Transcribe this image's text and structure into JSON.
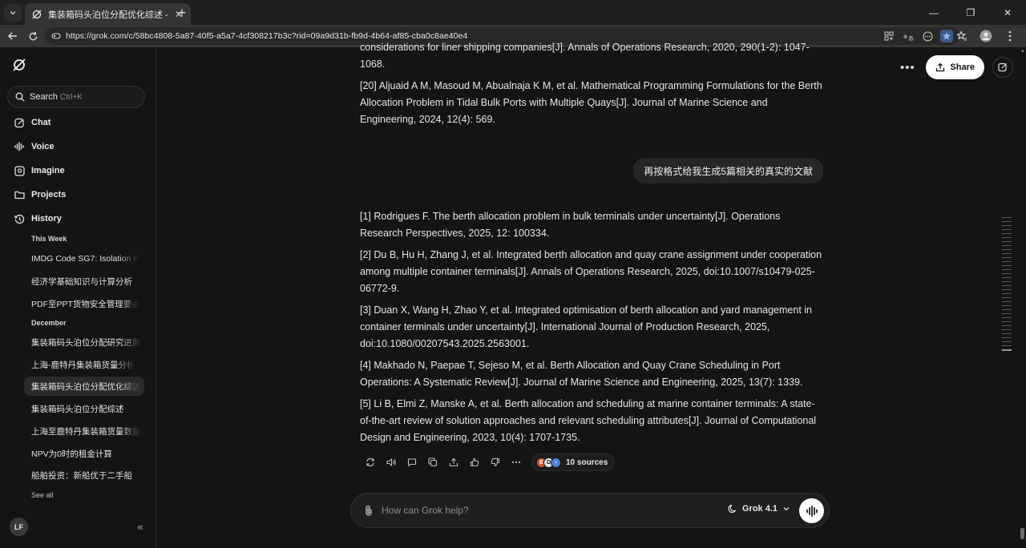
{
  "browser": {
    "tab_title": "集装箱码头泊位分配优化综述 - Grok",
    "url": "https://grok.com/c/58bc4808-5a87-40f5-a5a7-4cf308217b3c?rid=09a9d31b-fb9d-4b64-af85-cba0c8ae40e4"
  },
  "sidebar": {
    "search_label": "Search",
    "search_shortcut": "Ctrl+K",
    "nav": [
      {
        "label": "Chat",
        "icon": "chat-icon"
      },
      {
        "label": "Voice",
        "icon": "voice-icon"
      },
      {
        "label": "Imagine",
        "icon": "imagine-icon"
      },
      {
        "label": "Projects",
        "icon": "projects-icon"
      },
      {
        "label": "History",
        "icon": "history-icon"
      }
    ],
    "section_this_week": "This Week",
    "this_week": [
      "IMDG Code SG7: Isolation R",
      "经济学基础知识与计算分析",
      "PDF至PPT货物安全管理要点"
    ],
    "section_december": "December",
    "december": [
      "集装箱码头泊位分配研究进展",
      "上海-鹿特丹集装箱货量分析",
      "集装箱码头泊位分配优化综述",
      "集装箱码头泊位分配综述",
      "上海至鹿特丹集装箱货量数据",
      "NPV为0时的租金计算",
      "船舶投资：新船优于二手船"
    ],
    "see_all": "See all",
    "avatar_initials": "LF"
  },
  "header": {
    "share_label": "Share"
  },
  "conversation": {
    "prev_ref_tail": "considerations for liner shipping companies[J]. Annals of Operations Research, 2020, 290(1-2): 1047-1068.",
    "prev_ref_20": "[20] Aljuaid A M, Masoud M, Abualnaja K M, et al. Mathematical Programming Formulations for the Berth Allocation Problem in Tidal Bulk Ports with Multiple Quays[J]. Journal of Marine Science and Engineering, 2024, 12(4): 569.",
    "user_message": "再按格式给我生成5篇相关的真实的文献",
    "refs": [
      "[1] Rodrigues F. The berth allocation problem in bulk terminals under uncertainty[J]. Operations Research Perspectives, 2025, 12: 100334.",
      "[2] Du B, Hu H, Zhang J, et al. Integrated berth allocation and quay crane assignment under cooperation among multiple container terminals[J]. Annals of Operations Research, 2025, doi:10.1007/s10479-025-06772-9.",
      "[3] Duan X, Wang H, Zhao Y, et al. Integrated optimisation of berth allocation and yard management in container terminals under uncertainty[J]. International Journal of Production Research, 2025, doi:10.1080/00207543.2025.2563001.",
      "[4] Makhado N, Paepae T, Sejeso M, et al. Berth Allocation and Quay Crane Scheduling in Port Operations: A Systematic Review[J]. Journal of Marine Science and Engineering, 2025, 13(7): 1339.",
      "[5] Li B, Elmi Z, Manske A, et al. Berth allocation and scheduling at marine container terminals: A state-of-the-art review of solution approaches and relevant scheduling attributes[J]. Journal of Computational Design and Engineering, 2023, 10(4): 1707-1735."
    ],
    "sources_label": "10 sources"
  },
  "composer": {
    "placeholder": "How can Grok help?",
    "model_label": "Grok 4.1"
  },
  "colors": {
    "background": "#141414",
    "surface": "#1f1f1f",
    "text": "#e6e6e6",
    "browser_toolbar": "#353535"
  }
}
